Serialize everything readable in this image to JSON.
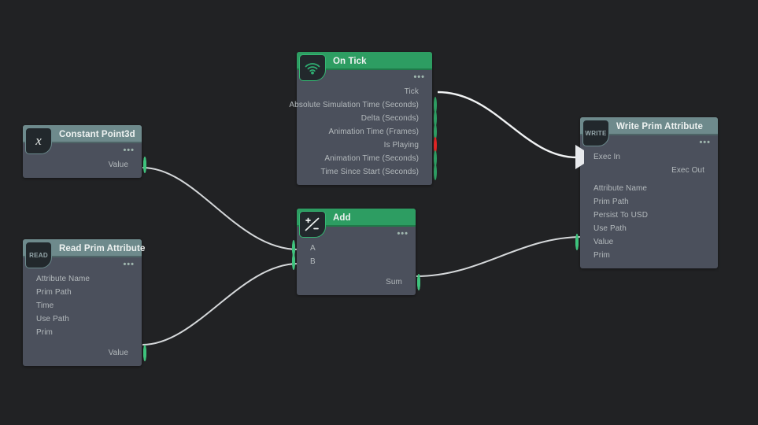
{
  "canvas": {
    "background": "#212224",
    "wire_color": "#d8dadc",
    "exec_wire_color": "#f1f3f4"
  },
  "palette": {
    "green_header": "#2d9d62",
    "teal_header": "#6e8a8c",
    "node_body": "#4b505c",
    "magenta_port": "#c44a9e",
    "red_port": "#e02424",
    "blue_port": "#3d7fd6",
    "green_port": "#2d9d62",
    "value_port": "#9aa0a6"
  },
  "nodes": [
    {
      "id": "constant_point3d",
      "title": "Constant Point3d",
      "badge": "x",
      "badge_style": "italic-x",
      "header_color": "teal",
      "menu_dots": "•••",
      "inputs": [],
      "outputs": [
        {
          "label": "Value",
          "port": "ring-filled",
          "color": "#9aa0a6"
        }
      ]
    },
    {
      "id": "read_prim_attribute",
      "title": "Read Prim Attribute",
      "badge": "READ",
      "badge_style": "text",
      "header_color": "teal",
      "menu_dots": "•••",
      "inputs": [
        {
          "label": "Attribute Name",
          "port": "pin-d",
          "color": "#c44a9e"
        },
        {
          "label": "Prim Path",
          "port": "pin-d",
          "color": "#c44a9e"
        },
        {
          "label": "Time",
          "port": "pin-d",
          "color": "#23a06a"
        },
        {
          "label": "Use Path",
          "port": "pin-d",
          "color": "#e02424"
        },
        {
          "label": "Prim",
          "port": "pin-d",
          "color": "#3d7fd6"
        }
      ],
      "outputs": [
        {
          "label": "Value",
          "port": "ring-filled",
          "color": "#9aa0a6"
        }
      ]
    },
    {
      "id": "on_tick",
      "title": "On Tick",
      "badge": "wifi-icon",
      "badge_style": "icon",
      "header_color": "green",
      "menu_dots": "•••",
      "inputs": [],
      "outputs": [
        {
          "label": "Tick",
          "port": "exec-d",
          "color": "#e8eaed"
        },
        {
          "label": "Absolute Simulation Time (Seconds)",
          "port": "ring",
          "color": "#2d9d62"
        },
        {
          "label": "Delta (Seconds)",
          "port": "ring",
          "color": "#2d9d62"
        },
        {
          "label": "Animation Time (Frames)",
          "port": "ring",
          "color": "#2d9d62"
        },
        {
          "label": "Is Playing",
          "port": "ring",
          "color": "#e02424"
        },
        {
          "label": "Animation Time (Seconds)",
          "port": "ring",
          "color": "#2d9d62"
        },
        {
          "label": "Time Since Start (Seconds)",
          "port": "ring",
          "color": "#2d9d62"
        }
      ]
    },
    {
      "id": "add",
      "title": "Add",
      "badge": "plus-minus-icon",
      "badge_style": "icon",
      "header_color": "green",
      "menu_dots": "•••",
      "inputs": [
        {
          "label": "A",
          "port": "ring-filled",
          "color": "#9aa0a6"
        },
        {
          "label": "B",
          "port": "ring-filled",
          "color": "#9aa0a6"
        }
      ],
      "outputs": [
        {
          "label": "Sum",
          "port": "ring-filled",
          "color": "#9aa0a6"
        }
      ]
    },
    {
      "id": "write_prim_attribute",
      "title": "Write Prim Attribute",
      "badge": "WRITE",
      "badge_style": "text",
      "header_color": "teal",
      "menu_dots": "•••",
      "inputs": [
        {
          "label": "Exec In",
          "port": "exec-arrow",
          "color": "#e8eaed"
        },
        {
          "label": "Attribute Name",
          "port": "pin-d",
          "color": "#c44a9e"
        },
        {
          "label": "Prim Path",
          "port": "pin-d",
          "color": "#c44a9e"
        },
        {
          "label": "Persist To USD",
          "port": "pin-d",
          "color": "#e02424"
        },
        {
          "label": "Use Path",
          "port": "pin-d",
          "color": "#e02424"
        },
        {
          "label": "Value",
          "port": "ring-filled",
          "color": "#9aa0a6"
        },
        {
          "label": "Prim",
          "port": "pin-d",
          "color": "#3d7fd6"
        }
      ],
      "outputs": [
        {
          "label": "Exec Out",
          "port": "exec-d-gray",
          "color": "#9aa0a6"
        }
      ]
    }
  ],
  "connections": [
    {
      "from_node": "on_tick",
      "from_port": "Tick",
      "to_node": "write_prim_attribute",
      "to_port": "Exec In",
      "kind": "exec"
    },
    {
      "from_node": "constant_point3d",
      "from_port": "Value",
      "to_node": "add",
      "to_port": "A",
      "kind": "data"
    },
    {
      "from_node": "read_prim_attribute",
      "from_port": "Value",
      "to_node": "add",
      "to_port": "B",
      "kind": "data"
    },
    {
      "from_node": "add",
      "from_port": "Sum",
      "to_node": "write_prim_attribute",
      "to_port": "Value",
      "kind": "data"
    }
  ]
}
